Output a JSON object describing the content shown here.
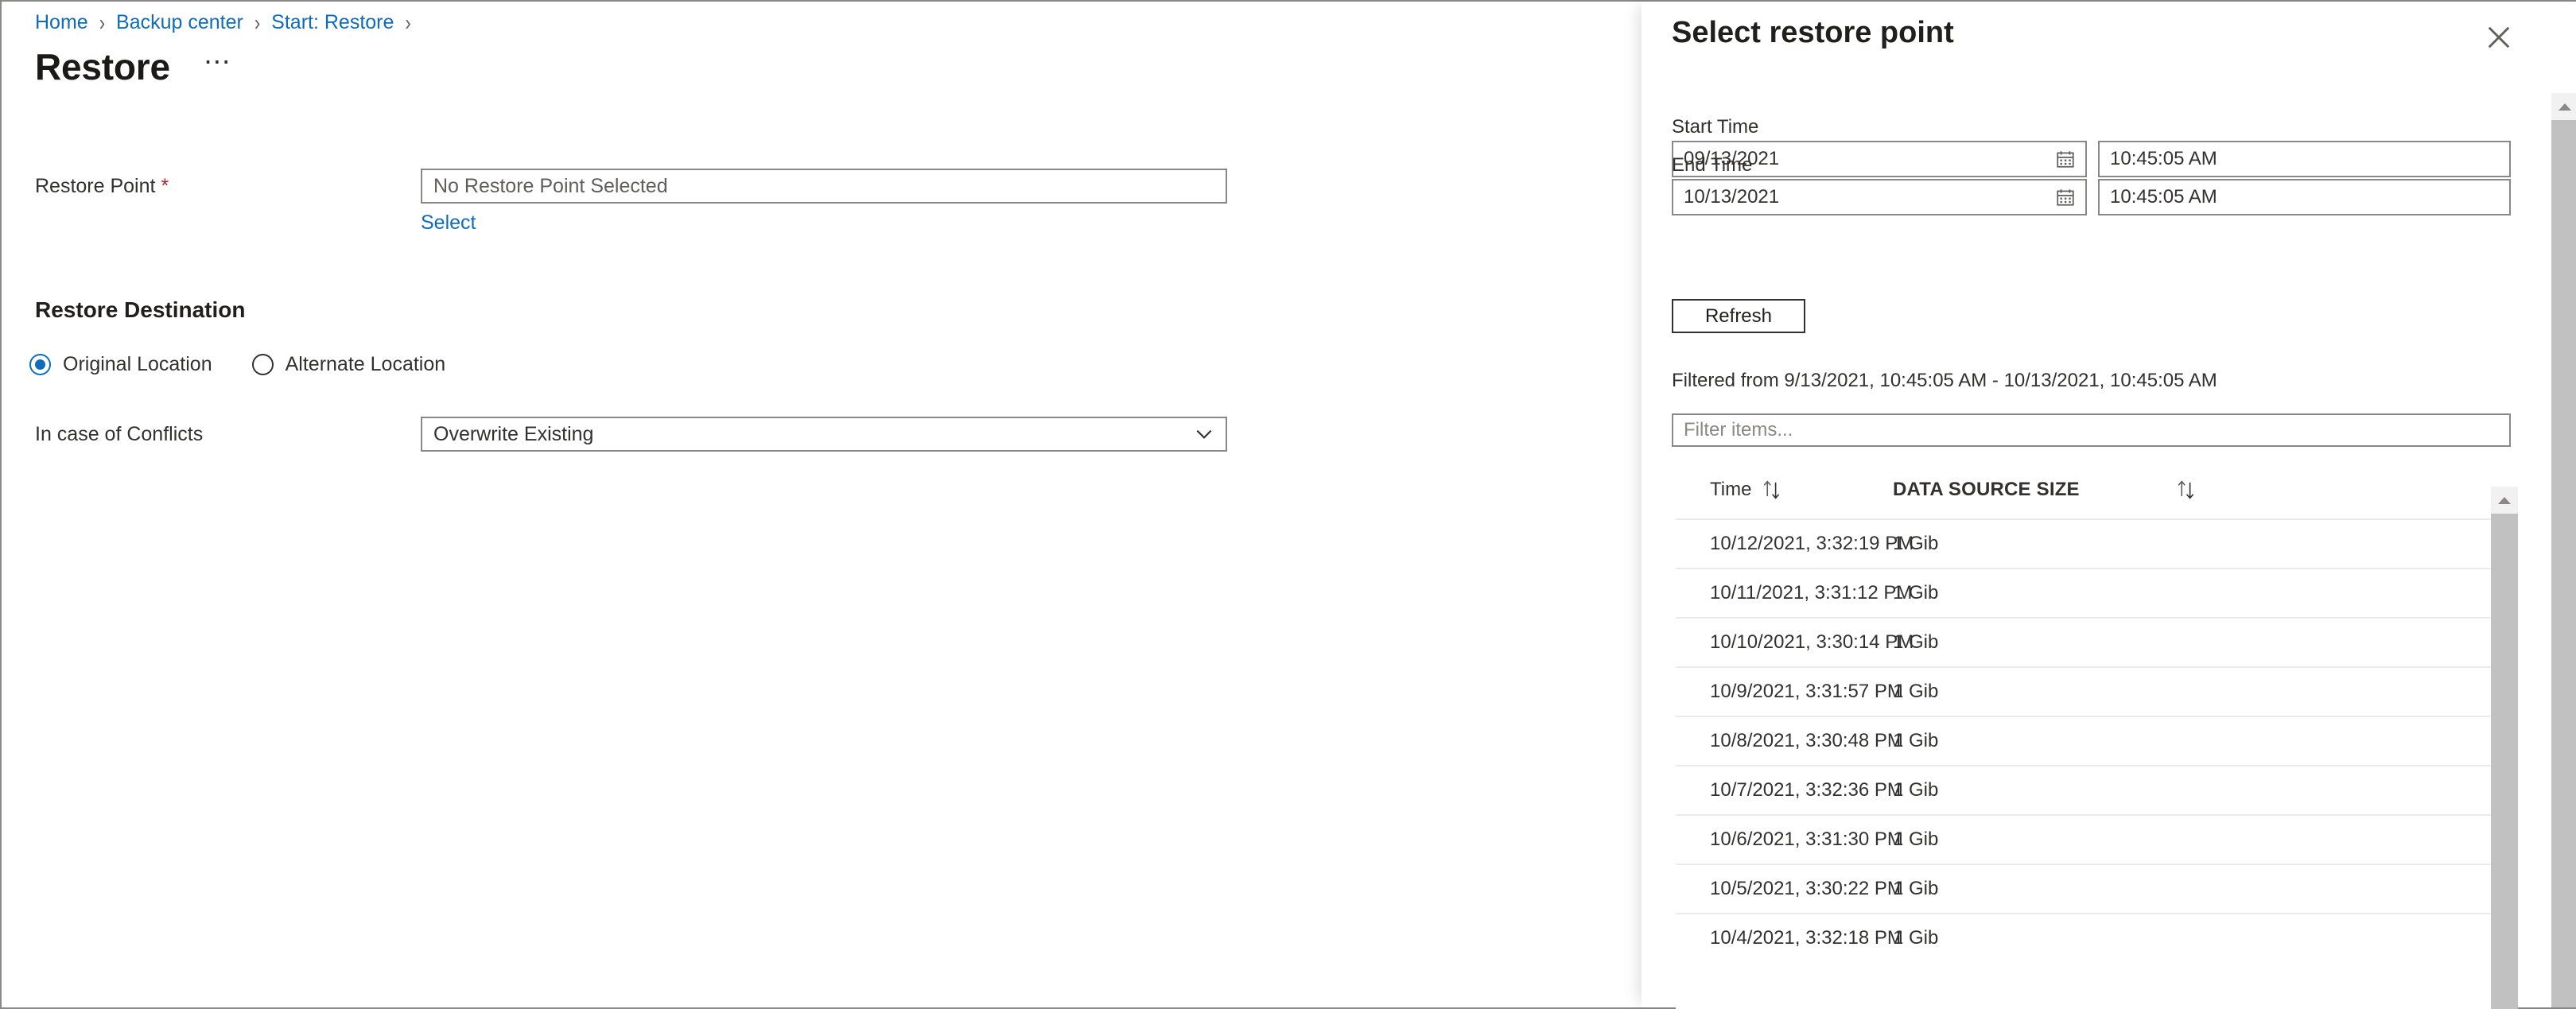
{
  "breadcrumb": {
    "items": [
      {
        "label": "Home"
      },
      {
        "label": "Backup center"
      },
      {
        "label": "Start: Restore"
      }
    ],
    "separator": "›"
  },
  "page": {
    "title": "Restore",
    "more_label": "⋯"
  },
  "form": {
    "restore_point": {
      "label": "Restore Point",
      "required_mark": "*",
      "value": "No Restore Point Selected",
      "placeholder": "No Restore Point Selected",
      "select_link": "Select"
    },
    "restore_destination": {
      "heading": "Restore Destination",
      "options": [
        {
          "label": "Original Location",
          "selected": true
        },
        {
          "label": "Alternate Location",
          "selected": false
        }
      ]
    },
    "conflicts": {
      "label": "In case of Conflicts",
      "value": "Overwrite Existing"
    }
  },
  "panel": {
    "title": "Select restore point",
    "close_label": "✕",
    "start_time": {
      "label": "Start Time",
      "date": "09/13/2021",
      "time": "10:45:05 AM"
    },
    "end_time": {
      "label": "End Time",
      "date": "10/13/2021",
      "time": "10:45:05 AM"
    },
    "refresh_label": "Refresh",
    "filtered_note": "Filtered from 9/13/2021, 10:45:05 AM - 10/13/2021, 10:45:05 AM",
    "filter_placeholder": "Filter items...",
    "table": {
      "columns": [
        {
          "key": "time",
          "label": "Time",
          "sortable": true
        },
        {
          "key": "size",
          "label": "DATA SOURCE SIZE",
          "sortable": true
        }
      ],
      "rows": [
        {
          "time": "10/12/2021, 3:32:19 PM",
          "size": "1  Gib"
        },
        {
          "time": "10/11/2021, 3:31:12 PM",
          "size": "1  Gib"
        },
        {
          "time": "10/10/2021, 3:30:14 PM",
          "size": "1  Gib"
        },
        {
          "time": "10/9/2021, 3:31:57 PM",
          "size": "1  Gib"
        },
        {
          "time": "10/8/2021, 3:30:48 PM",
          "size": "1  Gib"
        },
        {
          "time": "10/7/2021, 3:32:36 PM",
          "size": "1  Gib"
        },
        {
          "time": "10/6/2021, 3:31:30 PM",
          "size": "1  Gib"
        },
        {
          "time": "10/5/2021, 3:30:22 PM",
          "size": "1  Gib"
        },
        {
          "time": "10/4/2021, 3:32:18 PM",
          "size": "1  Gib"
        }
      ]
    }
  },
  "colors": {
    "link": "#0f6cbd",
    "accent": "#0f6cbd",
    "required": "#a4262c",
    "text": "#323130",
    "border": "#8a8886"
  }
}
